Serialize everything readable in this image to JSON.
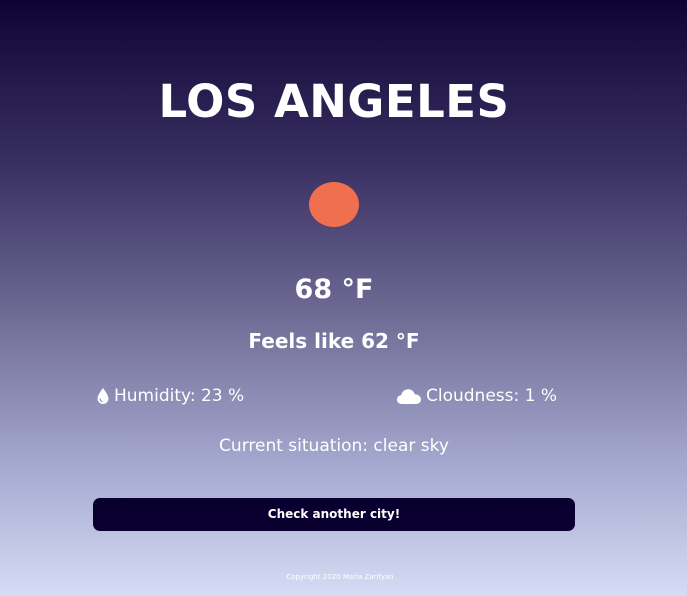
{
  "weather": {
    "city": "LOS ANGELES",
    "temperature": "68 °F",
    "feels_like": "Feels like 62 °F",
    "humidity": "Humidity: 23 %",
    "cloudiness": "Cloudness: 1 %",
    "situation": "Current situation: clear sky",
    "icon": "sun-icon"
  },
  "actions": {
    "check_another_city": "Check another city!"
  },
  "footer": {
    "copyright": "Copyright 2020 Maria Zarifyan"
  },
  "colors": {
    "sun": "#ef6f4e",
    "button_bg": "#0a0030",
    "gradient_top": "#0e0333",
    "gradient_bottom": "#d6dcf4"
  }
}
